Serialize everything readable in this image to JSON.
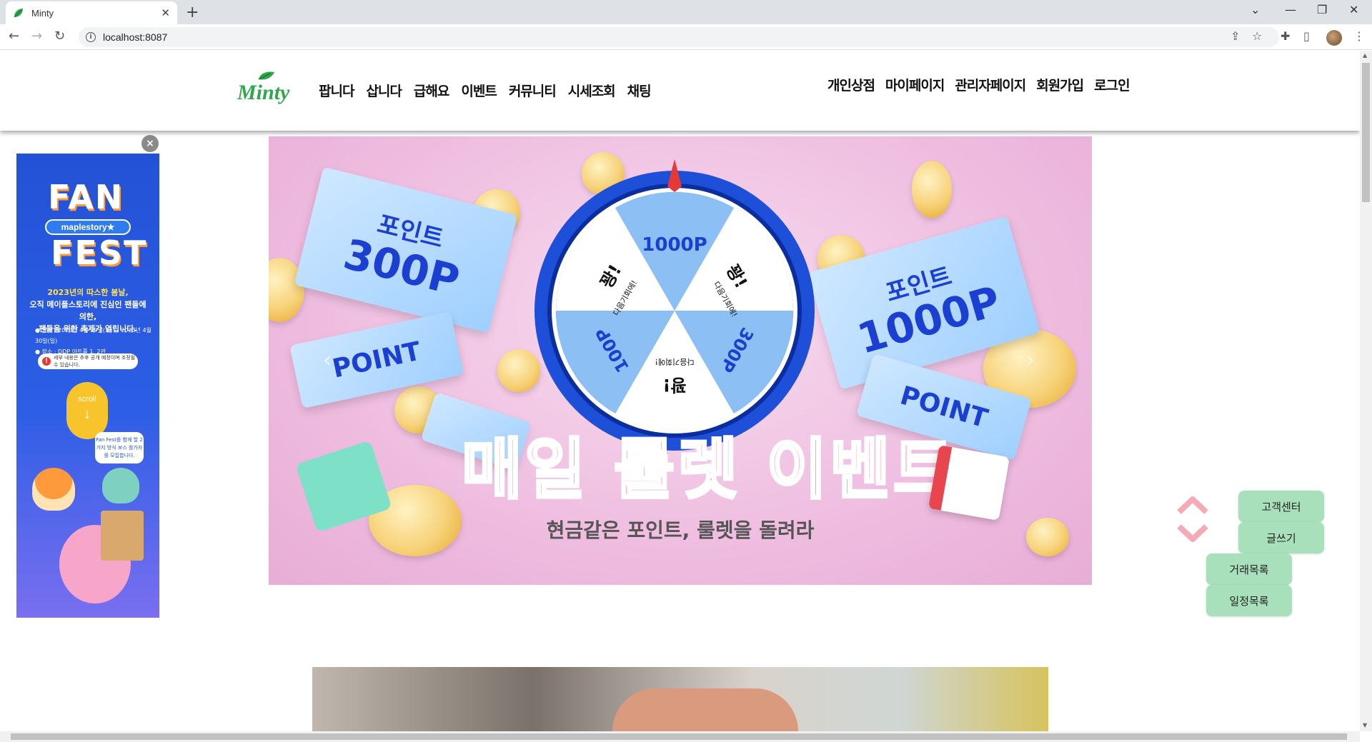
{
  "browser": {
    "tab_title": "Minty",
    "url": "localhost:8087"
  },
  "header": {
    "logo_text": "Minty",
    "nav_left": [
      "팝니다",
      "삽니다",
      "급해요",
      "이벤트",
      "커뮤니티",
      "시세조회",
      "채팅"
    ],
    "nav_right": [
      "개인상점",
      "마이페이지",
      "관리자페이지",
      "회원가입",
      "로그인"
    ]
  },
  "side_ad": {
    "close_label": "×",
    "title_top": "FAN",
    "badge": "maplestory★",
    "title_bottom": "FEST",
    "description_1": "2023년의 따스한 봄날,",
    "description_2": "오직 메이플스토리에 진심인 팬들에 의한,",
    "description_3": "팬들을 위한 축제가 열립니다.",
    "info_1": "● 일시 : 2023년 4월 29일(토) ~ 2023년 4월 30일(일)",
    "info_2": "● 장소 : DDP 아트홀 1, 2관",
    "warning": "세부 내용은 추후 공개 예정이며 조정될 수 있습니다.",
    "scroll_label": "scroll",
    "scroll_arrow": "↓",
    "bubble": "Fan Fest를 함께 할 2가지 방식 보스 참가자를 모집합니다."
  },
  "banner": {
    "title": "매일 룰렛 이벤트",
    "subtitle": "현금같은 포인트, 룰렛을 돌려라",
    "ticket_left_label": "포인트",
    "ticket_left_value": "300P",
    "ticket_left_point": "POINT",
    "ticket_right_label": "포인트",
    "ticket_right_value": "1000P",
    "ticket_right_point": "POINT",
    "wheel": {
      "seg_top": "1000P",
      "seg_top_right_1": "꽝!",
      "seg_top_right_2": "다음기회에!",
      "seg_bottom_right": "300P",
      "seg_bottom_1": "꽝!",
      "seg_bottom_2": "다음기회에!",
      "seg_bottom_left": "100P",
      "seg_top_left_1": "꽝!",
      "seg_top_left_2": "다음기회에!"
    },
    "prev_arrow": "‹",
    "next_arrow": "›"
  },
  "floating": {
    "customer_center": "고객센터",
    "write": "글쓰기",
    "trade_list": "거래목록",
    "schedule_list": "일정목록"
  },
  "colors": {
    "mint_button": "#a8e0bc",
    "logo_green": "#2ea84a",
    "banner_title": "#ff7a8e",
    "wheel_blue": "#1e4fd8"
  }
}
